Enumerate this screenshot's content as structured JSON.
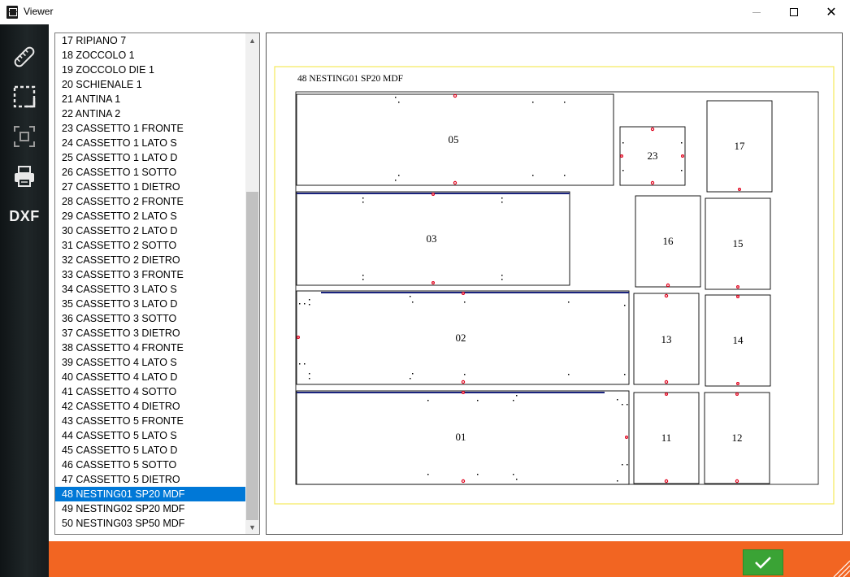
{
  "window": {
    "title": "Viewer",
    "close_glyph": "✕"
  },
  "sidebar": {
    "tools": [
      {
        "name": "measure",
        "icon": "ruler-icon"
      },
      {
        "name": "select",
        "icon": "selection-box-icon"
      },
      {
        "name": "fit",
        "icon": "fit-view-icon"
      },
      {
        "name": "print",
        "icon": "printer-icon"
      },
      {
        "name": "dxf",
        "label": "DXF"
      }
    ]
  },
  "list": {
    "selected_index": 31,
    "items": [
      "17 RIPIANO 7",
      "18 ZOCCOLO 1",
      "19 ZOCCOLO DIE 1",
      "20 SCHIENALE 1",
      "21 ANTINA 1",
      "22 ANTINA 2",
      "23 CASSETTO 1 FRONTE",
      "24 CASSETTO 1 LATO S",
      "25 CASSETTO 1 LATO D",
      "26 CASSETTO 1 SOTTO",
      "27 CASSETTO 1 DIETRO",
      "28 CASSETTO 2 FRONTE",
      "29 CASSETTO 2 LATO S",
      "30 CASSETTO 2 LATO D",
      "31 CASSETTO 2 SOTTO",
      "32 CASSETTO 2 DIETRO",
      "33 CASSETTO 3 FRONTE",
      "34 CASSETTO 3 LATO S",
      "35 CASSETTO 3 LATO D",
      "36 CASSETTO 3 SOTTO",
      "37 CASSETTO 3 DIETRO",
      "38 CASSETTO 4 FRONTE",
      "39 CASSETTO 4 LATO S",
      "40 CASSETTO 4 LATO D",
      "41 CASSETTO 4 SOTTO",
      "42 CASSETTO 4 DIETRO",
      "43 CASSETTO 5 FRONTE",
      "44 CASSETTO 5 LATO S",
      "45 CASSETTO 5 LATO D",
      "46 CASSETTO 5 SOTTO",
      "47 CASSETTO 5 DIETRO",
      "48 NESTING01 SP20 MDF",
      "49 NESTING02 SP20 MDF",
      "50 NESTING03 SP50 MDF"
    ]
  },
  "viewer": {
    "sheet_title": "48 NESTING01 SP20 MDF",
    "parts": [
      {
        "label": "05"
      },
      {
        "label": "23"
      },
      {
        "label": "17"
      },
      {
        "label": "03"
      },
      {
        "label": "16"
      },
      {
        "label": "15"
      },
      {
        "label": "02"
      },
      {
        "label": "13"
      },
      {
        "label": "14"
      },
      {
        "label": "01"
      },
      {
        "label": "11"
      },
      {
        "label": "12"
      }
    ]
  },
  "colors": {
    "sidebar": "#1b2224",
    "accent_bar": "#f26522",
    "confirm": "#3aa335",
    "selection": "#0078d7",
    "sheet_border": "#f5e85a",
    "edge_band": "#1a237e",
    "hole": "#e0001b"
  },
  "footer": {
    "confirm_icon": "checkmark-icon"
  }
}
